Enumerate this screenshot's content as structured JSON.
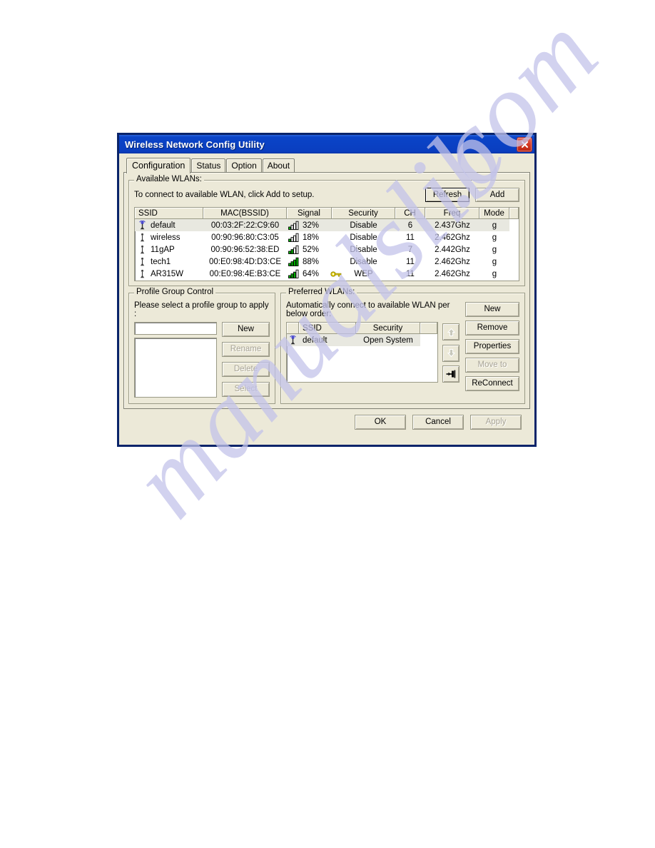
{
  "window": {
    "title": "Wireless Network Config Utility",
    "close_label": "x"
  },
  "tabs": [
    {
      "label": "Configuration",
      "active": true
    },
    {
      "label": "Status",
      "active": false
    },
    {
      "label": "Option",
      "active": false
    },
    {
      "label": "About",
      "active": false
    }
  ],
  "available_wlans": {
    "group_title": "Available WLANs:",
    "hint": "To connect to available WLAN, click Add to setup.",
    "refresh_label": "Refresh",
    "add_label": "Add",
    "columns": [
      "SSID",
      "MAC(BSSID)",
      "Signal",
      "Security",
      "CH",
      "Freq",
      "Mode"
    ],
    "rows": [
      {
        "ssid": "default",
        "icon": "ap-connected-icon",
        "mac": "00:03:2F:22:C9:60",
        "signal": "32%",
        "signal_pct": 32,
        "bars": 1,
        "secured": false,
        "security": "Disable",
        "ch": "6",
        "freq": "2.437Ghz",
        "mode": "g",
        "selected": true
      },
      {
        "ssid": "wireless",
        "icon": "station-icon",
        "mac": "00:90:96:80:C3:05",
        "signal": "18%",
        "signal_pct": 18,
        "bars": 1,
        "secured": false,
        "security": "Disable",
        "ch": "11",
        "freq": "2.462Ghz",
        "mode": "g",
        "selected": false
      },
      {
        "ssid": "11gAP",
        "icon": "station-icon",
        "mac": "00:90:96:52:38:ED",
        "signal": "52%",
        "signal_pct": 52,
        "bars": 2,
        "secured": false,
        "security": "Disable",
        "ch": "7",
        "freq": "2.442Ghz",
        "mode": "g",
        "selected": false
      },
      {
        "ssid": "tech1",
        "icon": "station-icon",
        "mac": "00:E0:98:4D:D3:CE",
        "signal": "88%",
        "signal_pct": 88,
        "bars": 4,
        "secured": false,
        "security": "Disable",
        "ch": "11",
        "freq": "2.462Ghz",
        "mode": "g",
        "selected": false
      },
      {
        "ssid": "AR315W",
        "icon": "station-icon",
        "mac": "00:E0:98:4E:B3:CE",
        "signal": "64%",
        "signal_pct": 64,
        "bars": 3,
        "secured": true,
        "security": "WEP",
        "ch": "11",
        "freq": "2.462Ghz",
        "mode": "g",
        "selected": false
      }
    ]
  },
  "profile_group_control": {
    "group_title": "Profile Group Control",
    "hint": "Please select a profile group to apply :",
    "input_value": "",
    "input_placeholder": "",
    "list_items": [],
    "buttons": [
      {
        "label": "New",
        "enabled": true
      },
      {
        "label": "Rename",
        "enabled": false
      },
      {
        "label": "Delete",
        "enabled": false
      },
      {
        "label": "Select",
        "enabled": false
      }
    ]
  },
  "preferred_wlans": {
    "group_title": "Preferred WLANs:",
    "hint": "Automatically connect to available WLAN per below order:",
    "columns": [
      "",
      "SSID",
      "Security",
      ""
    ],
    "rows": [
      {
        "icon": "ap-connected-icon",
        "ssid": "default",
        "security": "Open System",
        "selected": true
      }
    ],
    "order_buttons": [
      {
        "name": "move-up-button",
        "icon": "arrow-up-icon"
      },
      {
        "name": "move-down-button",
        "icon": "arrow-down-icon"
      },
      {
        "name": "connect-pin-button",
        "icon": "pin-icon"
      }
    ],
    "buttons": [
      {
        "label": "New",
        "enabled": true
      },
      {
        "label": "Remove",
        "enabled": true
      },
      {
        "label": "Properties",
        "enabled": true
      },
      {
        "label": "Move to",
        "enabled": false
      },
      {
        "label": "ReConnect",
        "enabled": true
      }
    ]
  },
  "footer": {
    "ok_label": "OK",
    "cancel_label": "Cancel",
    "apply_label": "Apply",
    "apply_enabled": false
  },
  "watermark": {
    "line1": "manualslib",
    "line2": ".com"
  },
  "colors": {
    "titlebar_blue": "#0a44c8",
    "dialog_face": "#ece9d8",
    "frame_navy": "#0a246a",
    "close_red": "#d63a26",
    "signal_green": "#00b000",
    "key_yellow": "#e8d515",
    "watermark": "#c3c3ea"
  }
}
